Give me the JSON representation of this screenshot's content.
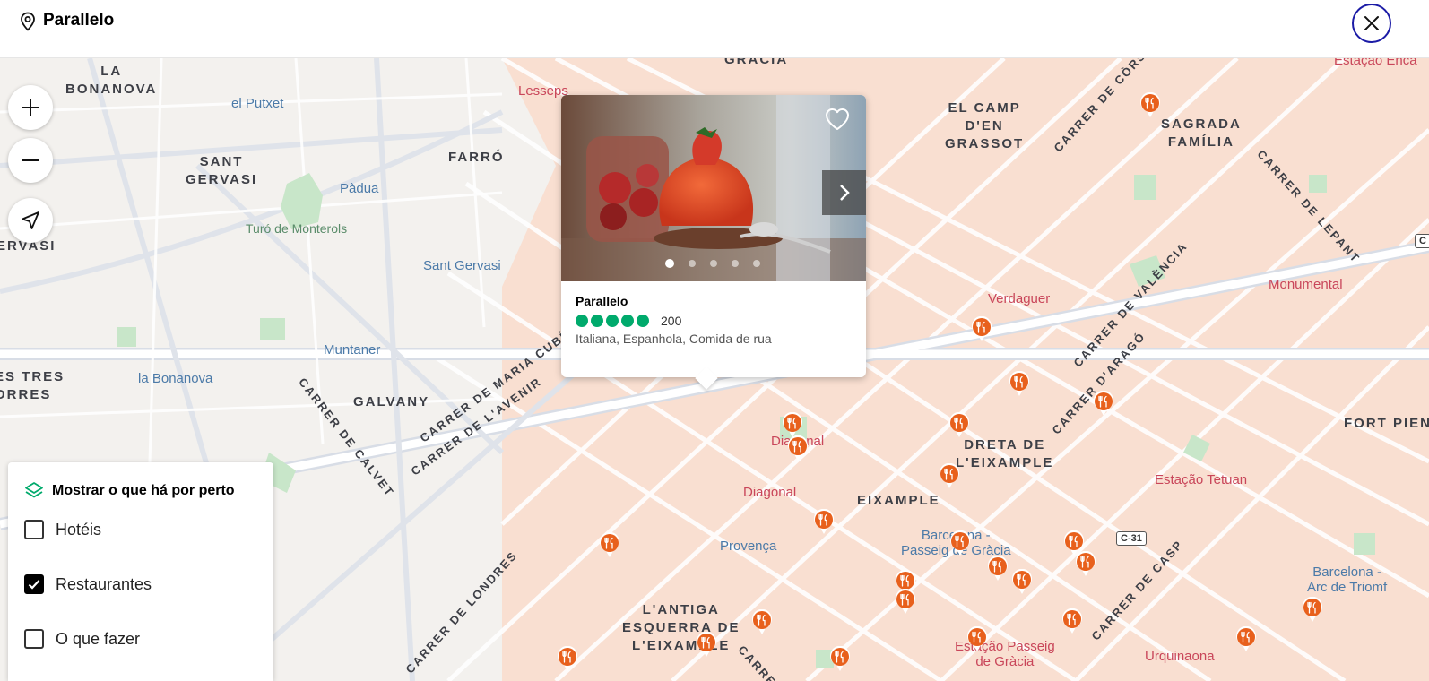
{
  "header": {
    "title": "Parallelo"
  },
  "map": {
    "areas": [
      "LA\nBONANOVA",
      "SANT\nGERVASI",
      "FARRÓ",
      "EL CAMP\nD'EN\nGRASSOT",
      "SAGRADA\nFAMÍLIA",
      "ES TRES\nORRES",
      "GALVANY",
      "DRETA DE\nL'EIXAMPLE",
      "EIXAMPLE",
      "FORT PIENC",
      "L'ANTIGA\nESQUERRA DE\nL'EIXAMPLE",
      "GRÀCIA",
      "ERVASI"
    ],
    "stations": [
      "el Putxet",
      "Pàdua",
      "Sant Gervasi",
      "Muntaner",
      "la Bonanova",
      "Provença",
      "Barcelona -\nPasseig de Gràcia",
      "Barcelona -\nArc de Triomf"
    ],
    "metro": [
      "Lesseps",
      "Verdaguer",
      "Monumental",
      "Diagonal",
      "Diagonal",
      "Estação Tetuan",
      "Estação Passeig\nde Gràcia",
      "Urquinaona",
      "Estação Enca"
    ],
    "parks": [
      "Turó de Monterols"
    ],
    "streets": [
      "CARRER DE CÒRS",
      "CARRER DE LEPANT",
      "CARRER DE VALÈNCIA",
      "CARRER D'ARAGÓ",
      "CARRER DE MARIA CUBÍ",
      "CARRER DE L'AVENIR",
      "CARRER DE CALVET",
      "CARRER DE LONDRES",
      "CARRER DE CASP",
      "CARRE"
    ],
    "road_badges": [
      "C-31",
      "C"
    ]
  },
  "controls": {
    "zoom_in": "+",
    "zoom_out": "−"
  },
  "card": {
    "name": "Parallelo",
    "rating": 5,
    "reviews": "200",
    "cuisine": "Italiana, Espanhola, Comida de rua",
    "photo_count": 5,
    "active_photo": 1,
    "rating_color": "#00aa6c"
  },
  "nearby": {
    "title": "Mostrar o que há por perto",
    "options": [
      {
        "label": "Hotéis",
        "checked": false
      },
      {
        "label": "Restaurantes",
        "checked": true
      },
      {
        "label": "O que fazer",
        "checked": false
      }
    ]
  },
  "colors": {
    "marker": "#e8601c",
    "close_border": "#1b1ba6",
    "metro": "#c9465a"
  }
}
